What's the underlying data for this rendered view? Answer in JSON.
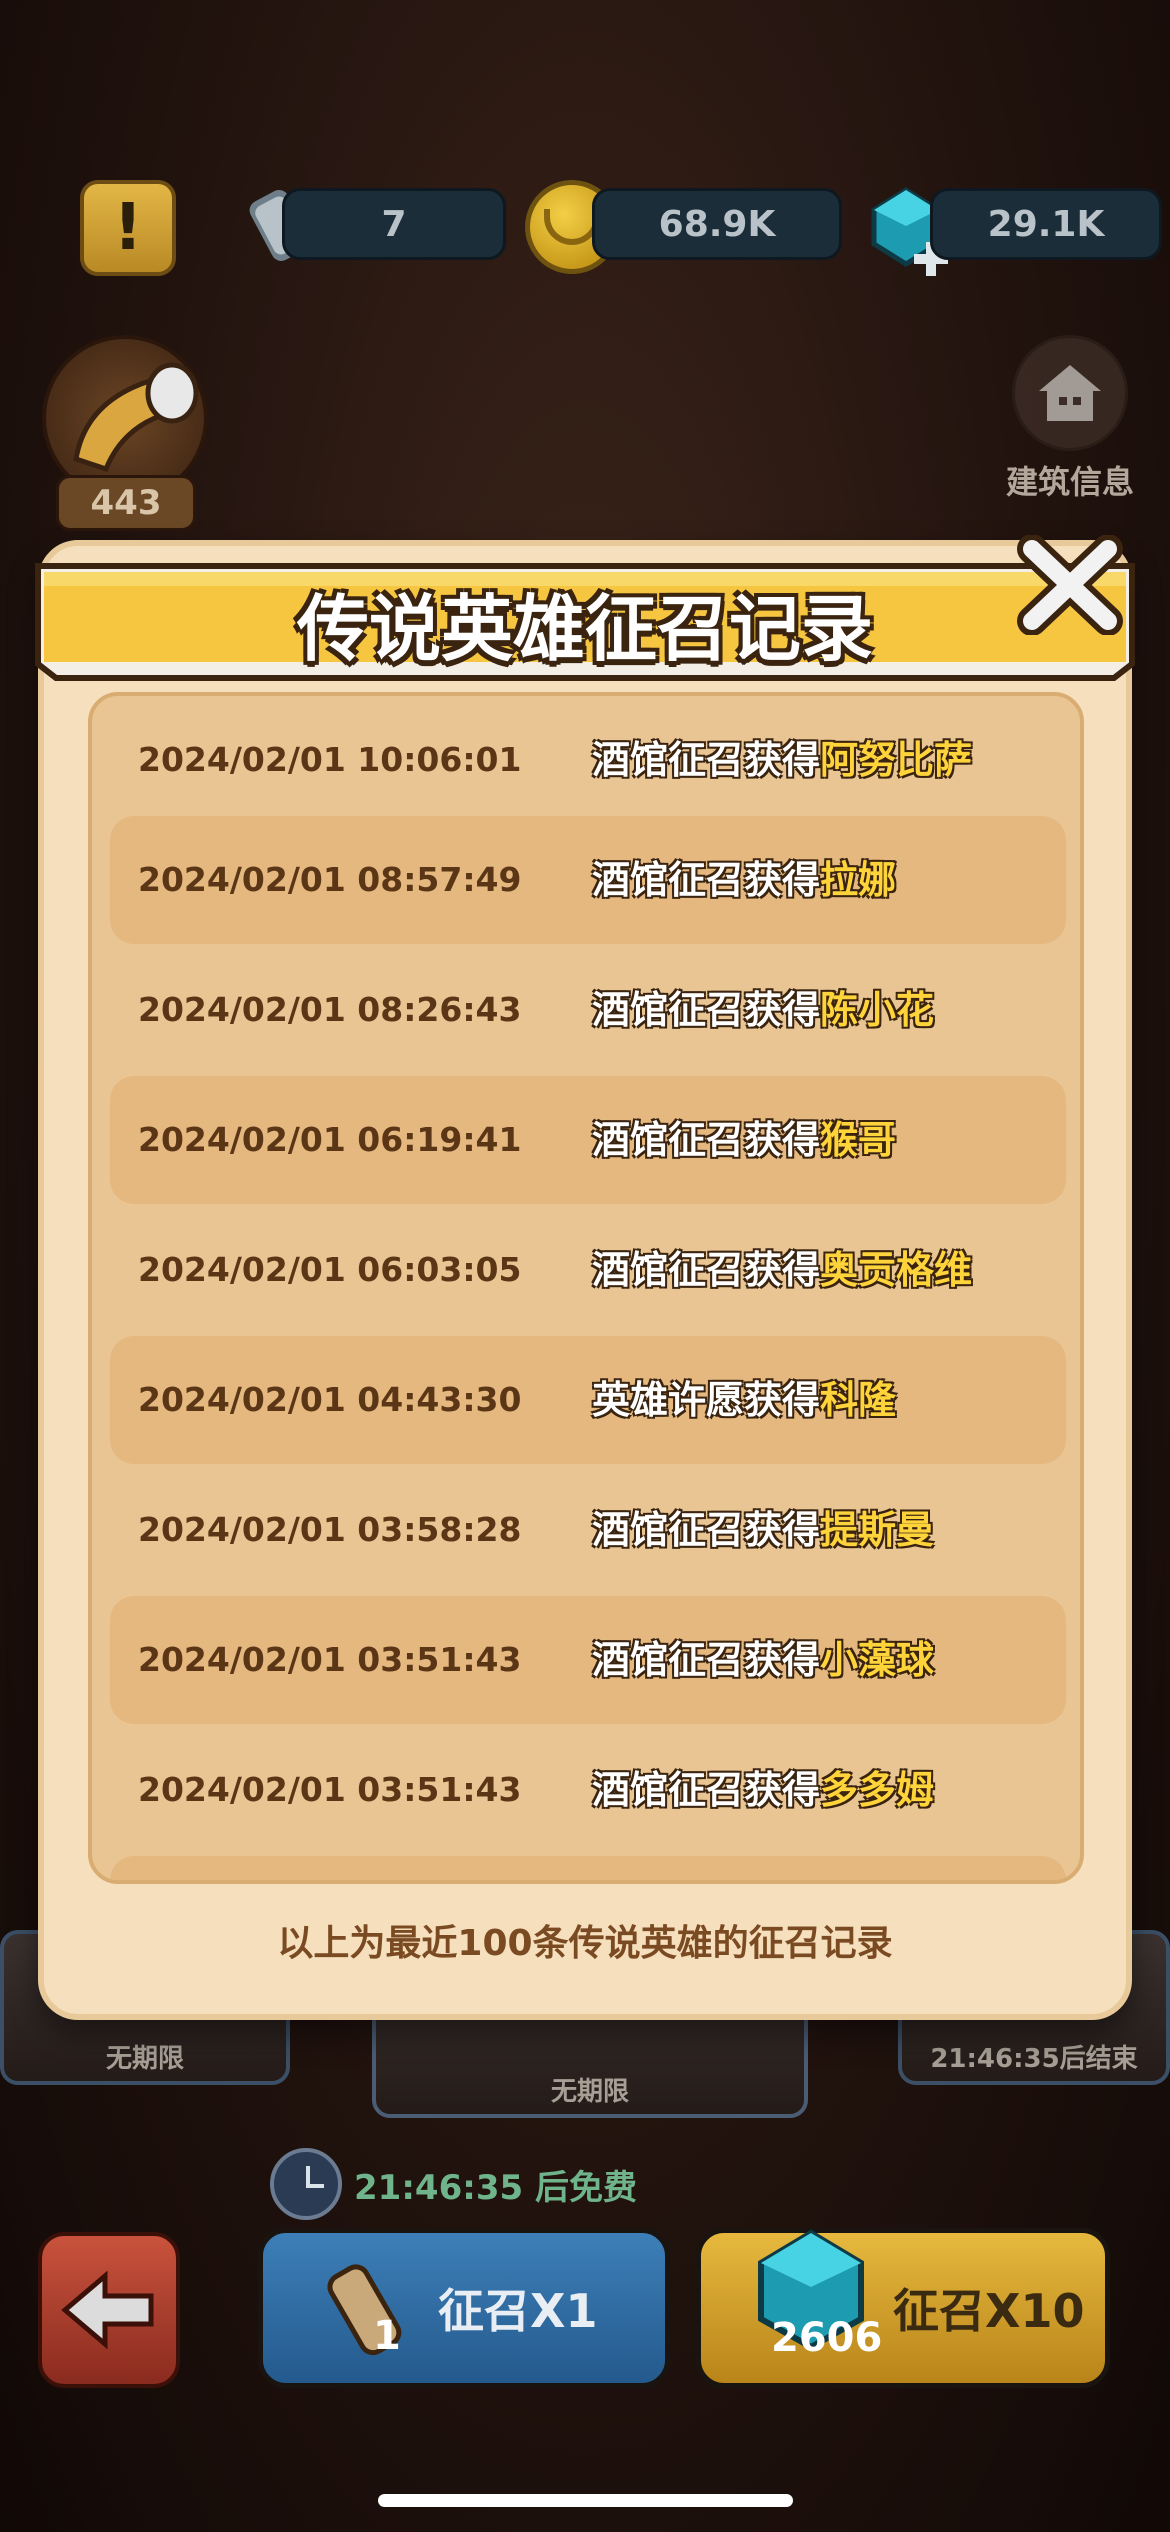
{
  "top_bar": {
    "scrolls": "7",
    "coins": "68.9K",
    "gems": "29.1K"
  },
  "horn": {
    "count": "443"
  },
  "building_info": {
    "label": "建筑信息"
  },
  "modal": {
    "title": "传说英雄征召记录",
    "records": [
      {
        "time": "2024/02/01 10:06:01",
        "action": "酒馆征召获得",
        "hero": "阿努比萨"
      },
      {
        "time": "2024/02/01 08:57:49",
        "action": "酒馆征召获得",
        "hero": "拉娜"
      },
      {
        "time": "2024/02/01 08:26:43",
        "action": "酒馆征召获得",
        "hero": "陈小花"
      },
      {
        "time": "2024/02/01 06:19:41",
        "action": "酒馆征召获得",
        "hero": "猴哥"
      },
      {
        "time": "2024/02/01 06:03:05",
        "action": "酒馆征召获得",
        "hero": "奥贡格维"
      },
      {
        "time": "2024/02/01 04:43:30",
        "action": "英雄许愿获得",
        "hero": "科隆"
      },
      {
        "time": "2024/02/01 03:58:28",
        "action": "酒馆征召获得",
        "hero": "提斯曼"
      },
      {
        "time": "2024/02/01 03:51:43",
        "action": "酒馆征召获得",
        "hero": "小藻球"
      },
      {
        "time": "2024/02/01 03:51:43",
        "action": "酒馆征召获得",
        "hero": "多多姆"
      }
    ],
    "footer": "以上为最近100条传说英雄的征召记录"
  },
  "background_cards": {
    "left_label": "无期限",
    "center_label": "无期限",
    "right_label": "21:46:35后结束"
  },
  "free_timer": "21:46:35 后免费",
  "summon_x1": {
    "label": "征召X1",
    "cost": "1"
  },
  "summon_x10": {
    "label": "征召X10",
    "cost": "2606"
  },
  "colors": {
    "modal_bg": "#f5dfbd",
    "banner_yellow": "#f6c641",
    "hero_highlight": "#ffd43b",
    "time_text": "#5a3616"
  }
}
